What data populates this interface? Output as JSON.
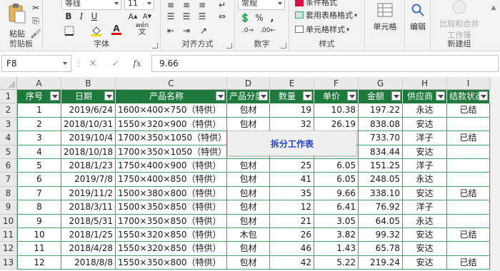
{
  "ribbon": {
    "paste_label": "粘贴",
    "clipboard_label": "剪贴板",
    "font_name": "等线",
    "font_size": "11",
    "font_label": "字体",
    "bold": "B",
    "italic": "I",
    "underline": "U",
    "font_color_glyph": "A",
    "wen": "wén",
    "alignment_label": "对齐方式",
    "number_format": "常规",
    "number_label": "数字",
    "percent": "%",
    "comma": ",",
    "cond_format": "条件格式",
    "table_format": "套用表格格式",
    "cell_style": "单元格样式",
    "styles_label": "样式",
    "cells_label": "单元格",
    "editing_label": "编辑",
    "compare_merge_1": "比较和合并",
    "compare_merge_2": "工作簿",
    "new_group_label": "新建组"
  },
  "formula_bar": {
    "name_box": "F8",
    "cancel": "✕",
    "enter": "✓",
    "fx": "fx",
    "value": "9.66"
  },
  "grid": {
    "columns": [
      "A",
      "B",
      "C",
      "D",
      "E",
      "F",
      "G",
      "H",
      "I"
    ],
    "rows": [
      "1",
      "2",
      "3",
      "4",
      "5",
      "6",
      "7",
      "8",
      "9",
      "10",
      "11",
      "12",
      "13"
    ],
    "headers": [
      "序号",
      "日期",
      "产品名称",
      "产品分类",
      "数量",
      "单价",
      "金额",
      "供应商",
      "结款状态"
    ],
    "records": [
      [
        "1",
        "2019/6/24",
        "1600×400×750（特供）",
        "包材",
        "19",
        "10.38",
        "197.22",
        "永达",
        "已结"
      ],
      [
        "2",
        "2018/10/31",
        "1550×320×900（特供）",
        "包材",
        "32",
        "26.19",
        "838.08",
        "安达",
        ""
      ],
      [
        "3",
        "2019/10/4",
        "1700×350×1050（特供）",
        "",
        "",
        "",
        "733.70",
        "洋子",
        "已结"
      ],
      [
        "4",
        "2018/10/18",
        "1700×350×1050（特供）",
        "",
        "",
        "",
        "834.44",
        "安达",
        ""
      ],
      [
        "5",
        "2018/1/23",
        "1750×400×900（特供）",
        "包材",
        "25",
        "6.05",
        "151.25",
        "洋子",
        ""
      ],
      [
        "6",
        "2019/7/8",
        "1750×400×850（特供）",
        "包材",
        "41",
        "6.05",
        "248.05",
        "永达",
        ""
      ],
      [
        "7",
        "2019/11/2",
        "1500×380×800（特供）",
        "包材",
        "35",
        "9.66",
        "338.10",
        "安达",
        "已结"
      ],
      [
        "8",
        "2018/3/11",
        "1500×350×850（特供）",
        "包材",
        "12",
        "6.41",
        "76.92",
        "洋子",
        ""
      ],
      [
        "9",
        "2018/5/31",
        "1700×350×850（特供）",
        "包材",
        "21",
        "3.05",
        "64.05",
        "永达",
        ""
      ],
      [
        "10",
        "2018/1/25",
        "1550×320×850（特供）",
        "木包",
        "26",
        "3.82",
        "99.32",
        "安达",
        "已结"
      ],
      [
        "11",
        "2018/4/28",
        "1550×320×850（特供）",
        "包材",
        "46",
        "1.43",
        "65.78",
        "安达",
        ""
      ],
      [
        "12",
        "2018/8/8",
        "1550×350×800（特供）",
        "包材",
        "42",
        "5.22",
        "219.24",
        "安达",
        "已结"
      ]
    ]
  },
  "popup": {
    "label": "拆分工作表"
  },
  "colors": {
    "header_green": "#1e7a3c",
    "border_green": "#4f9e6a",
    "popup_text": "#1f3fc0"
  }
}
